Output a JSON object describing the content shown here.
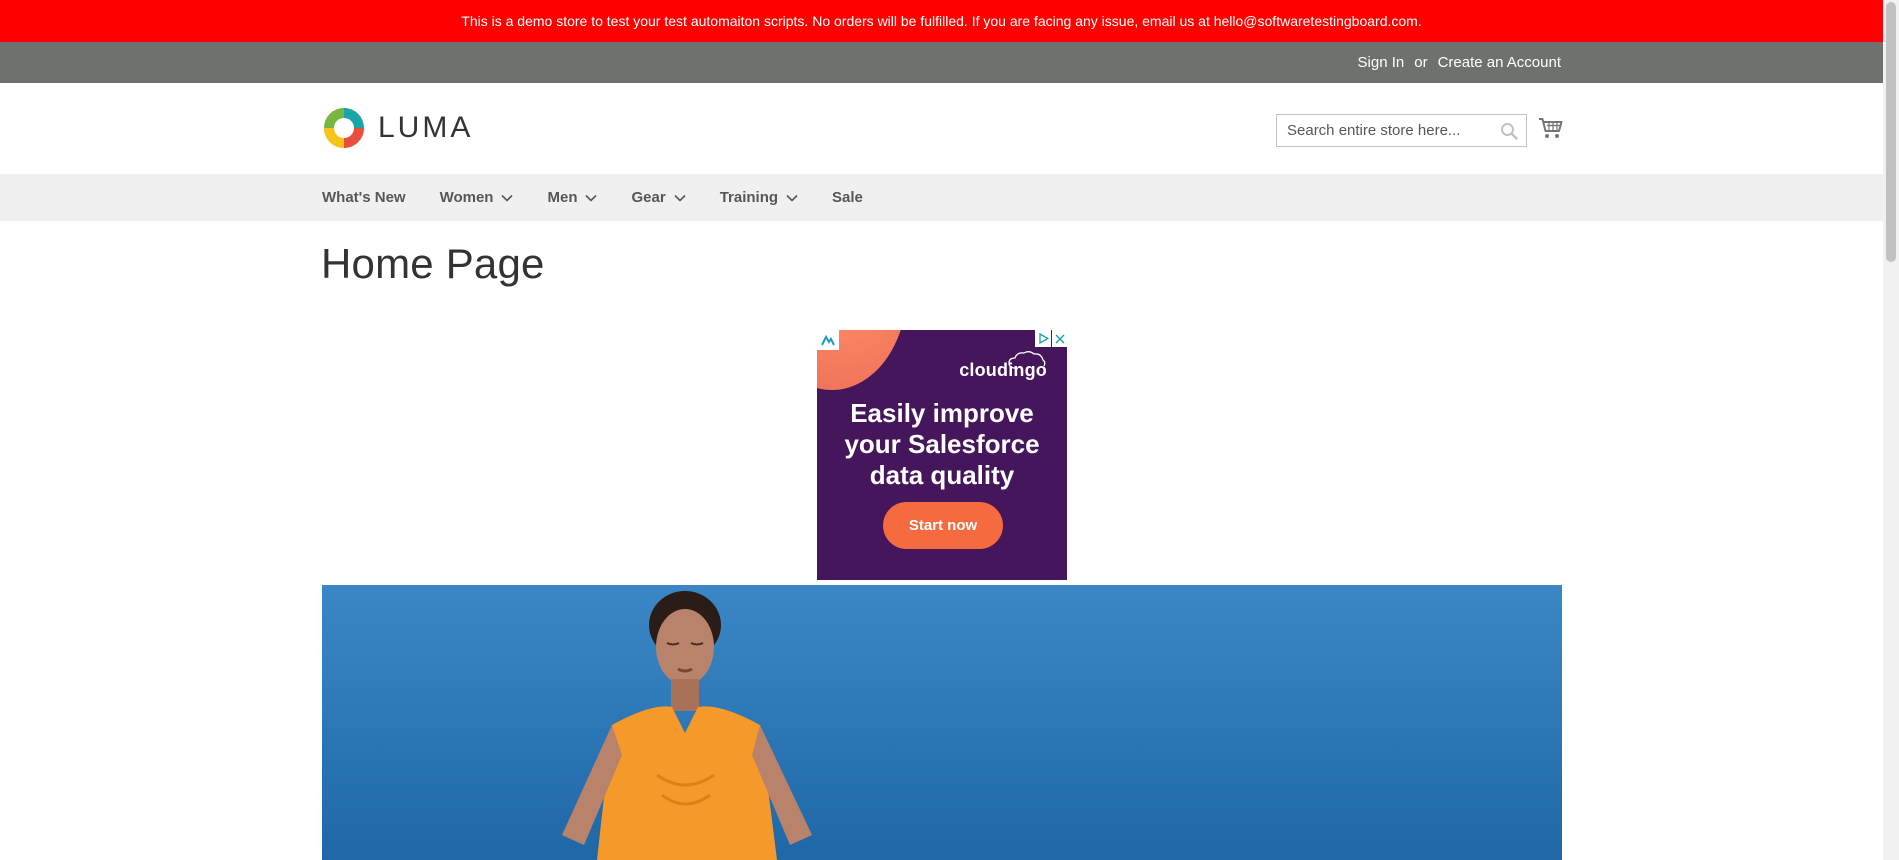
{
  "demo_notice": {
    "text": "This is a demo store to test your test automaiton scripts. No orders will be fulfilled. If you are facing any issue, email us at hello@softwaretestingboard.com."
  },
  "header_links": {
    "sign_in": "Sign In",
    "or": "or",
    "create_account": "Create an Account"
  },
  "logo": {
    "text": "LUMA",
    "icon": "luma-logo-icon"
  },
  "search": {
    "placeholder": "Search entire store here...",
    "icon": "search-icon"
  },
  "cart": {
    "icon": "cart-icon"
  },
  "nav": {
    "items": [
      {
        "label": "What's New",
        "has_submenu": false
      },
      {
        "label": "Women",
        "has_submenu": true
      },
      {
        "label": "Men",
        "has_submenu": true
      },
      {
        "label": "Gear",
        "has_submenu": true
      },
      {
        "label": "Training",
        "has_submenu": true
      },
      {
        "label": "Sale",
        "has_submenu": false
      }
    ]
  },
  "page": {
    "title": "Home Page"
  },
  "ad": {
    "brand": "cloudingo",
    "headline_line1": "Easily improve",
    "headline_line2": "your Salesforce",
    "headline_line3": "data quality",
    "cta": "Start now"
  },
  "colors": {
    "notice_bg": "#ff0000",
    "header_panel_bg": "#6e716e",
    "nav_bg": "#f0f0f0",
    "ad_bg": "#46165c",
    "ad_cta": "#f56b3f",
    "hero_bg": "#2f79b8"
  }
}
